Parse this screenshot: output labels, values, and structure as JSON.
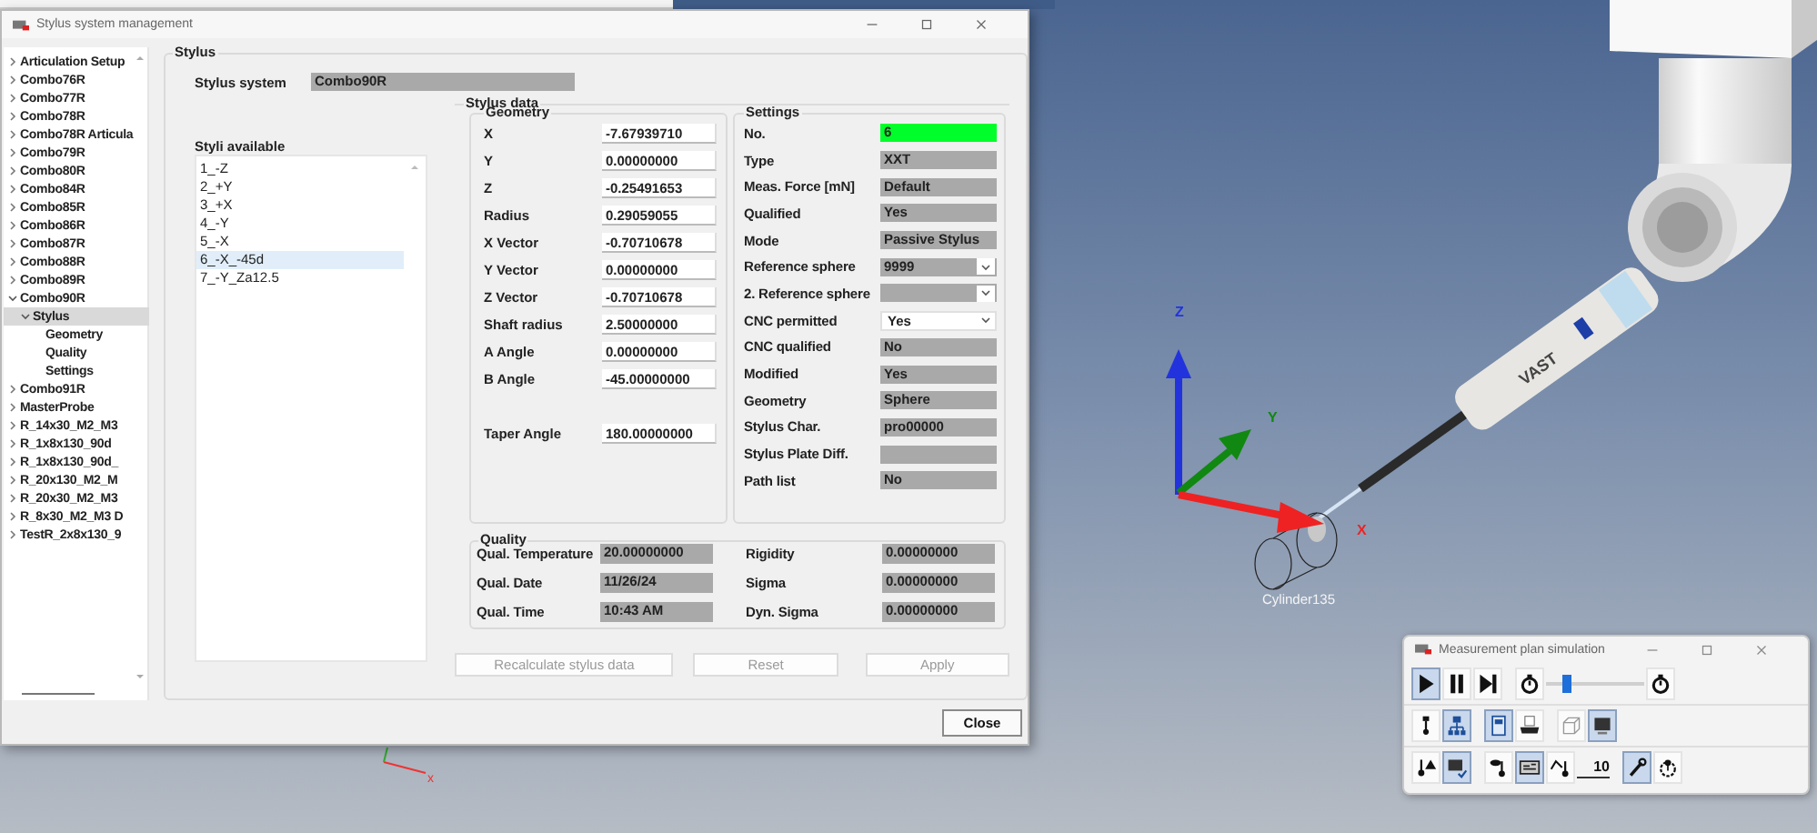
{
  "dialog": {
    "title": "Stylus system management",
    "tree": [
      {
        "label": "Articulation Setup",
        "expanded": false,
        "selected": false
      },
      {
        "label": "Combo76R",
        "expanded": false,
        "selected": false
      },
      {
        "label": "Combo77R",
        "expanded": false,
        "selected": false
      },
      {
        "label": "Combo78R",
        "expanded": false,
        "selected": false
      },
      {
        "label": "Combo78R Articula",
        "expanded": false,
        "selected": false
      },
      {
        "label": "Combo79R",
        "expanded": false,
        "selected": false
      },
      {
        "label": "Combo80R",
        "expanded": false,
        "selected": false
      },
      {
        "label": "Combo84R",
        "expanded": false,
        "selected": false
      },
      {
        "label": "Combo85R",
        "expanded": false,
        "selected": false
      },
      {
        "label": "Combo86R",
        "expanded": false,
        "selected": false
      },
      {
        "label": "Combo87R",
        "expanded": false,
        "selected": false
      },
      {
        "label": "Combo88R",
        "expanded": false,
        "selected": false
      },
      {
        "label": "Combo89R",
        "expanded": false,
        "selected": false
      },
      {
        "label": "Combo90R",
        "expanded": true,
        "selected": false,
        "children": [
          {
            "label": "Stylus",
            "expanded": true,
            "selected": true,
            "children": [
              {
                "label": "Geometry",
                "selected": false
              },
              {
                "label": "Quality",
                "selected": false
              },
              {
                "label": "Settings",
                "selected": false
              }
            ]
          }
        ]
      },
      {
        "label": "Combo91R",
        "expanded": false,
        "selected": false
      },
      {
        "label": "MasterProbe",
        "expanded": false,
        "selected": false
      },
      {
        "label": "R_14x30_M2_M3",
        "expanded": false,
        "selected": false
      },
      {
        "label": "R_1x8x130_90d",
        "expanded": false,
        "selected": false
      },
      {
        "label": "R_1x8x130_90d_",
        "expanded": false,
        "selected": false
      },
      {
        "label": "R_20x130_M2_M",
        "expanded": false,
        "selected": false
      },
      {
        "label": "R_20x30_M2_M3",
        "expanded": false,
        "selected": false
      },
      {
        "label": "R_8x30_M2_M3 D",
        "expanded": false,
        "selected": false
      },
      {
        "label": "TestR_2x8x130_9",
        "expanded": false,
        "selected": false
      }
    ],
    "group_title": "Stylus",
    "stylus_system": {
      "label": "Stylus system",
      "value": "Combo90R"
    },
    "styli": {
      "label": "Styli available",
      "items": [
        {
          "label": "1_-Z",
          "selected": false
        },
        {
          "label": "2_+Y",
          "selected": false
        },
        {
          "label": "3_+X",
          "selected": false
        },
        {
          "label": "4_-Y",
          "selected": false
        },
        {
          "label": "5_-X",
          "selected": false
        },
        {
          "label": "6_-X_-45d",
          "selected": true
        },
        {
          "label": "7_-Y_Za12.5",
          "selected": false
        }
      ]
    },
    "stylus_data": {
      "title": "Stylus data",
      "geometry": {
        "title": "Geometry",
        "rows": [
          {
            "label": "X",
            "value": "-7.67939710"
          },
          {
            "label": "Y",
            "value": "0.00000000"
          },
          {
            "label": "Z",
            "value": "-0.25491653"
          },
          {
            "label": "Radius",
            "value": "0.29059055"
          },
          {
            "label": "X Vector",
            "value": "-0.70710678"
          },
          {
            "label": "Y Vector",
            "value": "0.00000000"
          },
          {
            "label": "Z Vector",
            "value": "-0.70710678"
          },
          {
            "label": "Shaft radius",
            "value": "2.50000000"
          },
          {
            "label": "A Angle",
            "value": "0.00000000"
          },
          {
            "label": "B Angle",
            "value": "-45.00000000"
          },
          {
            "label": "Taper Angle",
            "value": "180.00000000"
          }
        ]
      },
      "settings": {
        "title": "Settings",
        "rows": [
          {
            "label": "No.",
            "value": "6",
            "kind": "highlight"
          },
          {
            "label": "Type",
            "value": "XXT",
            "kind": "readonly"
          },
          {
            "label": "Meas. Force [mN]",
            "value": "Default",
            "kind": "readonly"
          },
          {
            "label": "Qualified",
            "value": "Yes",
            "kind": "readonly"
          },
          {
            "label": "Mode",
            "value": "Passive Stylus",
            "kind": "readonly"
          },
          {
            "label": "Reference sphere",
            "value": "9999",
            "kind": "combo"
          },
          {
            "label": "2. Reference sphere",
            "kind": "combo"
          },
          {
            "label": "CNC permitted",
            "value": "Yes",
            "kind": "select"
          },
          {
            "label": "CNC qualified",
            "value": "No",
            "kind": "readonly"
          },
          {
            "label": "Modified",
            "value": "Yes",
            "kind": "readonly"
          },
          {
            "label": "Geometry",
            "value": "Sphere",
            "kind": "readonly"
          },
          {
            "label": "Stylus Char.",
            "value": "pro00000",
            "kind": "readonly"
          },
          {
            "label": "Stylus Plate Diff.",
            "kind": "readonly"
          },
          {
            "label": "Path list",
            "value": "No",
            "kind": "readonly"
          }
        ]
      }
    },
    "quality": {
      "title": "Quality",
      "rows": [
        {
          "label": "Qual. Temperature",
          "value": "20.00000000"
        },
        {
          "label": "Rigidity",
          "value": "0.00000000"
        },
        {
          "label": "Qual. Date",
          "value": "11/26/24"
        },
        {
          "label": "Sigma",
          "value": "0.00000000"
        },
        {
          "label": "Qual. Time",
          "value": "10:43 AM"
        },
        {
          "label": "Dyn. Sigma",
          "value": "0.00000000"
        }
      ]
    },
    "buttons": [
      {
        "label": "Recalculate stylus data",
        "disabled": true
      },
      {
        "label": "Reset",
        "disabled": true
      },
      {
        "label": "Apply",
        "disabled": true
      }
    ],
    "close_button": "Close"
  },
  "viewport": {
    "axes": [
      {
        "label": "Z",
        "color": "#2233dd"
      },
      {
        "label": "Y",
        "color": "#118811"
      },
      {
        "label": "X",
        "color": "#ee2222"
      }
    ],
    "probe_label": "VAST",
    "feature_label": "Cylinder135",
    "mini_axis_label": "x"
  },
  "simulation": {
    "title": "Measurement plan simulation",
    "toolbar_rows": [
      {
        "items": [
          {
            "kind": "button",
            "pressed": true
          },
          {
            "kind": "button",
            "pressed": false
          },
          {
            "kind": "button",
            "pressed": false
          },
          {
            "kind": "button",
            "pressed": false
          },
          {
            "kind": "slider",
            "level": 0.2
          },
          {
            "kind": "button",
            "pressed": false
          }
        ]
      },
      {
        "items": [
          {
            "kind": "button",
            "pressed": false
          },
          {
            "kind": "button",
            "pressed": true
          },
          {
            "kind": "button",
            "pressed": true
          },
          {
            "kind": "button",
            "pressed": false
          },
          {
            "kind": "button",
            "pressed": false
          },
          {
            "kind": "button",
            "pressed": true
          }
        ]
      },
      {
        "items": [
          {
            "kind": "button",
            "pressed": false
          },
          {
            "kind": "button",
            "pressed": true
          },
          {
            "kind": "button",
            "pressed": false
          },
          {
            "kind": "button",
            "pressed": true
          },
          {
            "kind": "button",
            "pressed": false
          },
          {
            "kind": "field",
            "value": "10"
          },
          {
            "kind": "button",
            "pressed": true
          },
          {
            "kind": "button",
            "pressed": false
          }
        ]
      }
    ]
  }
}
